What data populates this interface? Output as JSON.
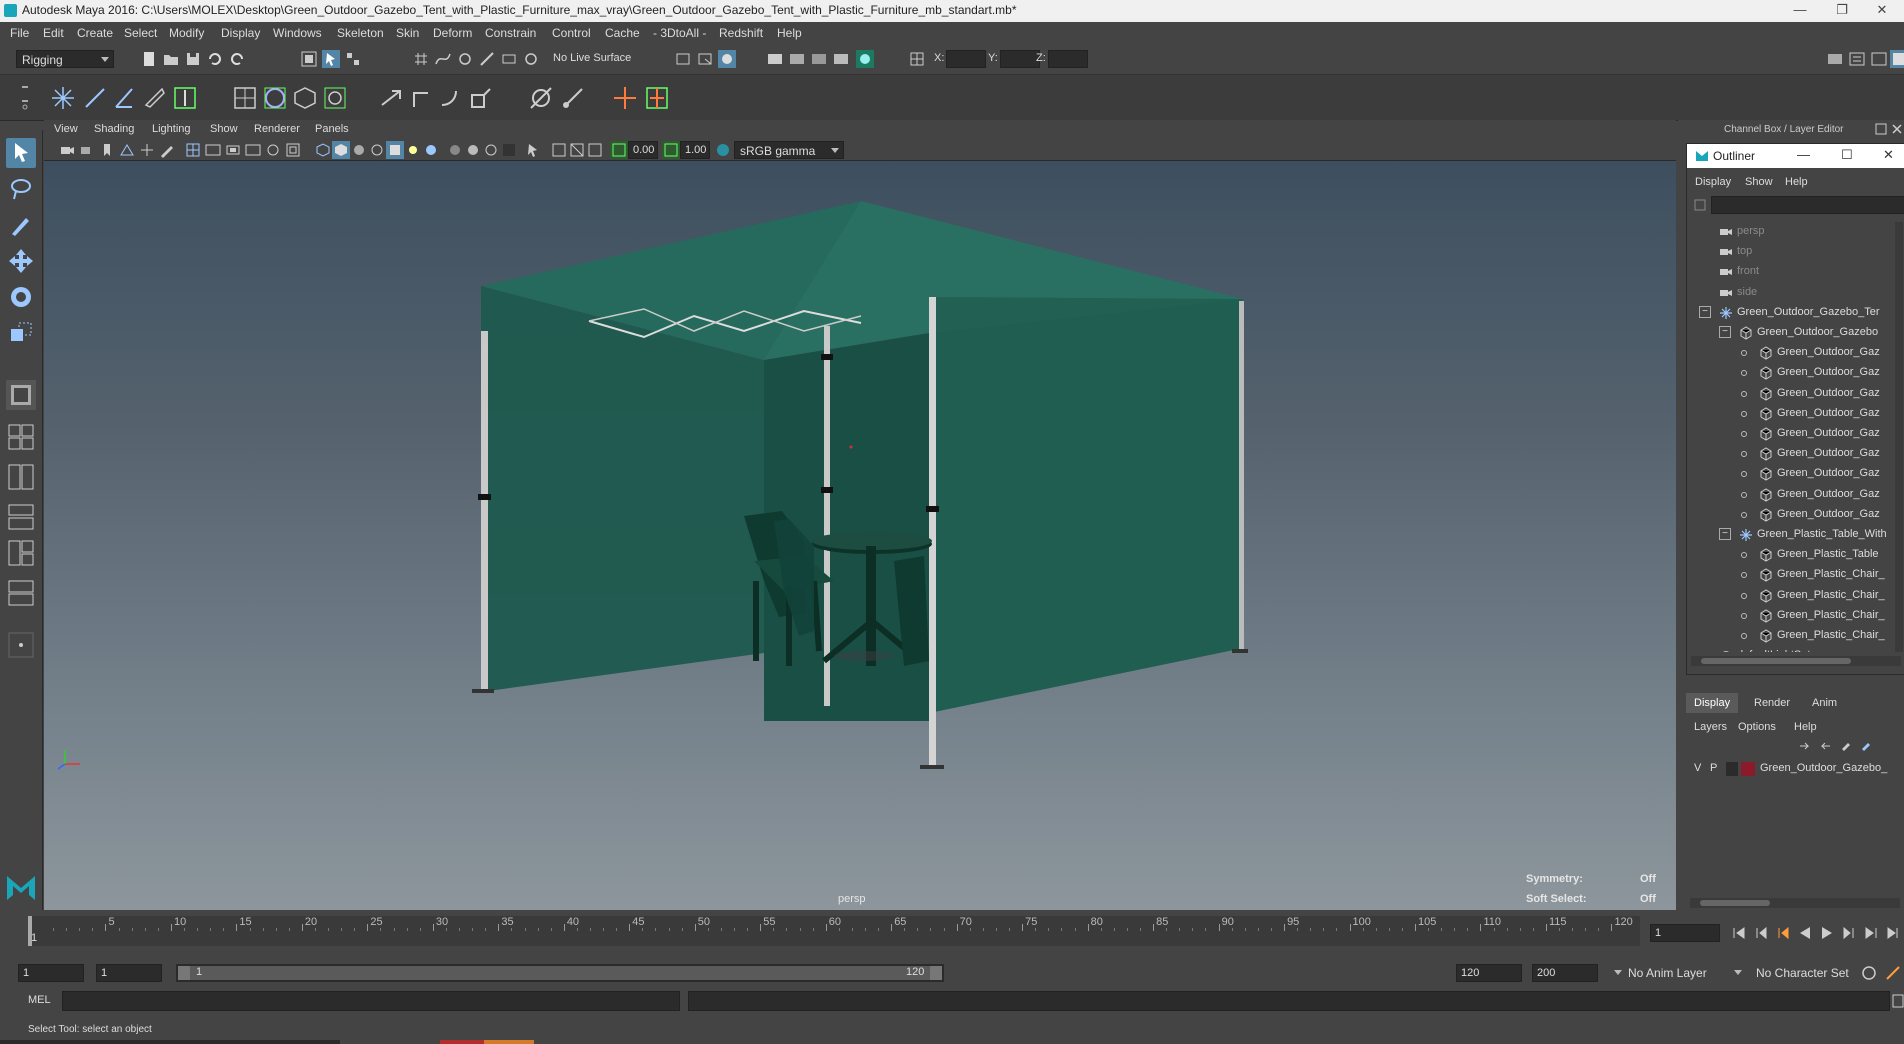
{
  "window": {
    "title": "Autodesk Maya 2016: C:\\Users\\MOLEX\\Desktop\\Green_Outdoor_Gazebo_Tent_with_Plastic_Furniture_max_vray\\Green_Outdoor_Gazebo_Tent_with_Plastic_Furniture_mb_standart.mb*",
    "controls": [
      "—",
      "❐",
      "✕"
    ]
  },
  "menubar": [
    "File",
    "Edit",
    "Create",
    "Select",
    "Modify",
    "Display",
    "Windows",
    "Skeleton",
    "Skin",
    "Deform",
    "Constrain",
    "Control",
    "Cache",
    "- 3DtoAll -",
    "Redshift",
    "Help"
  ],
  "status_line": {
    "menu_set": "Rigging",
    "live_surface": "No Live Surface",
    "x_label": "X:",
    "y_label": "Y:",
    "z_label": "Z:"
  },
  "viewport": {
    "menus": [
      "View",
      "Shading",
      "Lighting",
      "Show",
      "Renderer",
      "Panels"
    ],
    "exposure": "0.00",
    "gamma": "1.00",
    "color_space": "sRGB gamma",
    "camera_label": "persp",
    "symmetry_label": "Symmetry:",
    "symmetry_value": "Off",
    "soft_select_label": "Soft Select:",
    "soft_select_value": "Off"
  },
  "channel_box": {
    "title": "Channel Box / Layer Editor"
  },
  "outliner": {
    "title": "Outliner",
    "menus": [
      "Display",
      "Show",
      "Help"
    ],
    "items": [
      {
        "label": "persp",
        "depth": 0,
        "kind": "camera",
        "dim": true
      },
      {
        "label": "top",
        "depth": 0,
        "kind": "camera",
        "dim": true
      },
      {
        "label": "front",
        "depth": 0,
        "kind": "camera",
        "dim": true
      },
      {
        "label": "side",
        "depth": 0,
        "kind": "camera",
        "dim": true
      },
      {
        "label": "Green_Outdoor_Gazebo_Ter",
        "depth": 0,
        "kind": "group",
        "expander": "−"
      },
      {
        "label": "Green_Outdoor_Gazebo",
        "depth": 1,
        "kind": "mesh",
        "expander": "−"
      },
      {
        "label": "Green_Outdoor_Gaz",
        "depth": 2,
        "kind": "mesh"
      },
      {
        "label": "Green_Outdoor_Gaz",
        "depth": 2,
        "kind": "mesh"
      },
      {
        "label": "Green_Outdoor_Gaz",
        "depth": 2,
        "kind": "mesh"
      },
      {
        "label": "Green_Outdoor_Gaz",
        "depth": 2,
        "kind": "mesh"
      },
      {
        "label": "Green_Outdoor_Gaz",
        "depth": 2,
        "kind": "mesh"
      },
      {
        "label": "Green_Outdoor_Gaz",
        "depth": 2,
        "kind": "mesh"
      },
      {
        "label": "Green_Outdoor_Gaz",
        "depth": 2,
        "kind": "mesh"
      },
      {
        "label": "Green_Outdoor_Gaz",
        "depth": 2,
        "kind": "mesh"
      },
      {
        "label": "Green_Outdoor_Gaz",
        "depth": 2,
        "kind": "mesh"
      },
      {
        "label": "Green_Plastic_Table_With",
        "depth": 1,
        "kind": "group",
        "expander": "−"
      },
      {
        "label": "Green_Plastic_Table",
        "depth": 2,
        "kind": "mesh"
      },
      {
        "label": "Green_Plastic_Chair_",
        "depth": 2,
        "kind": "mesh"
      },
      {
        "label": "Green_Plastic_Chair_",
        "depth": 2,
        "kind": "mesh"
      },
      {
        "label": "Green_Plastic_Chair_",
        "depth": 2,
        "kind": "mesh"
      },
      {
        "label": "Green_Plastic_Chair_",
        "depth": 2,
        "kind": "mesh"
      },
      {
        "label": "defaultLightSet",
        "depth": 0,
        "kind": "set"
      }
    ]
  },
  "layer_editor": {
    "tabs": [
      "Display",
      "Render",
      "Anim"
    ],
    "active_tab": "Display",
    "menus": [
      "Layers",
      "Options",
      "Help"
    ],
    "layer": {
      "v": "V",
      "p": "P",
      "name": "Green_Outdoor_Gazebo_",
      "color": "#8b1a2b"
    }
  },
  "timeline": {
    "ticks": [
      "5",
      "10",
      "15",
      "20",
      "25",
      "30",
      "35",
      "40",
      "45",
      "50",
      "55",
      "60",
      "65",
      "70",
      "75",
      "80",
      "85",
      "90",
      "95",
      "100",
      "105",
      "110",
      "115",
      "120"
    ],
    "start_label": "1",
    "current_frame": "1"
  },
  "range": {
    "start": "1",
    "playback_start": "1",
    "slider_start": "1",
    "slider_end": "120",
    "playback_end": "120",
    "end": "200",
    "anim_layer": "No Anim Layer",
    "character_set": "No Character Set"
  },
  "command_line": {
    "label": "MEL"
  },
  "help_line": {
    "text": "Select Tool: select an object"
  },
  "colors": {
    "tent": "#1f5a4f",
    "tent_dark": "#184a41",
    "accent_teal": "#2a8fa0",
    "layer_red": "#8b1a2b"
  }
}
